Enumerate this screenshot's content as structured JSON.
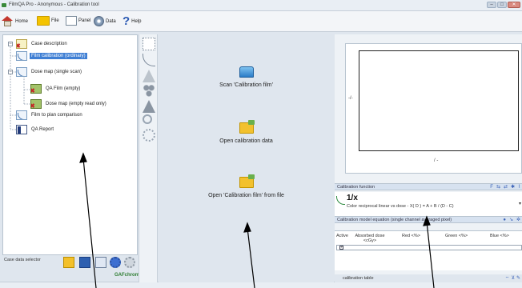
{
  "window": {
    "title": "FilmQA Pro - Anonymous - Calibration tool",
    "controls": [
      "–",
      "□",
      "✕"
    ]
  },
  "menubar": {
    "items": [
      {
        "label": "Home",
        "icon": "home-icon"
      },
      {
        "label": "File",
        "icon": "file-icon"
      },
      {
        "label": "Panel",
        "icon": "panel-icon"
      },
      {
        "label": "Data",
        "icon": "data-icon"
      },
      {
        "label": "Help",
        "icon": "help-icon"
      }
    ]
  },
  "tree": {
    "items": [
      {
        "label": "Case description",
        "icon": "case-description-icon",
        "selected": false
      },
      {
        "label": "Film calibration (ordinary)",
        "icon": "calibration-curve-icon",
        "selected": true
      },
      {
        "label": "Dose map (single scan)",
        "icon": "dose-map-icon",
        "selected": false
      },
      {
        "label": "QA Film (empty)",
        "icon": "film-icon",
        "selected": false
      },
      {
        "label": "Dose map (empty read only)",
        "icon": "film-icon",
        "selected": false
      },
      {
        "label": "Film to plan comparison",
        "icon": "comparison-icon",
        "selected": false
      },
      {
        "label": "QA Report",
        "icon": "report-icon",
        "selected": false
      }
    ]
  },
  "case_selector": {
    "label": "Case data selector",
    "logo": "GAFchromic"
  },
  "center_actions": [
    {
      "label": "Scan 'Calibration film'",
      "icon": "scanner-icon"
    },
    {
      "label": "Open calibration data",
      "icon": "open-folder-icon"
    },
    {
      "label": "Open 'Calibration film' from file",
      "icon": "open-folder-icon"
    }
  ],
  "plot": {
    "y_label": "-/-",
    "x_label": "/ -"
  },
  "calibration_function": {
    "header": "Calibration function",
    "name": "1/x",
    "description": "Color reciprocal linear vs dose - X( D ) = A + B / (D - C)"
  },
  "model_equation": {
    "header": "Calibration model equation (single channel averaged pixel)"
  },
  "table": {
    "columns": [
      "Active",
      "Absorbed dose <cGy>",
      "Red <%>",
      "Green <%>",
      "Blue <%>"
    ],
    "rows": [
      {
        "active": "✓"
      }
    ]
  },
  "footer": {
    "label": "calibration table"
  }
}
